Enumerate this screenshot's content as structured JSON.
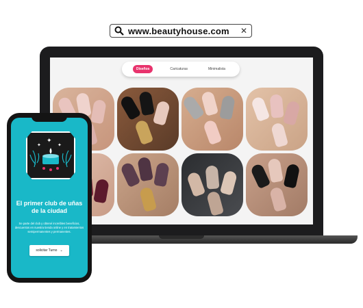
{
  "browser": {
    "url": "www.beautyhouse.com"
  },
  "site": {
    "tabs": [
      {
        "label": "Diseños",
        "active": true
      },
      {
        "label": "Caricaturas",
        "active": false
      },
      {
        "label": "Minimalista",
        "active": false
      }
    ],
    "accent": "#e8336d"
  },
  "phone": {
    "headline": "El primer club de uñas de la ciudad",
    "description": "Se parte del club y obtené increíbles beneficios, descuentos en nuestra tienda online y en tratamientos semipermanentes y permanentes.",
    "cta_label": "solicitar Turno",
    "bg_color": "#19b8c8"
  }
}
